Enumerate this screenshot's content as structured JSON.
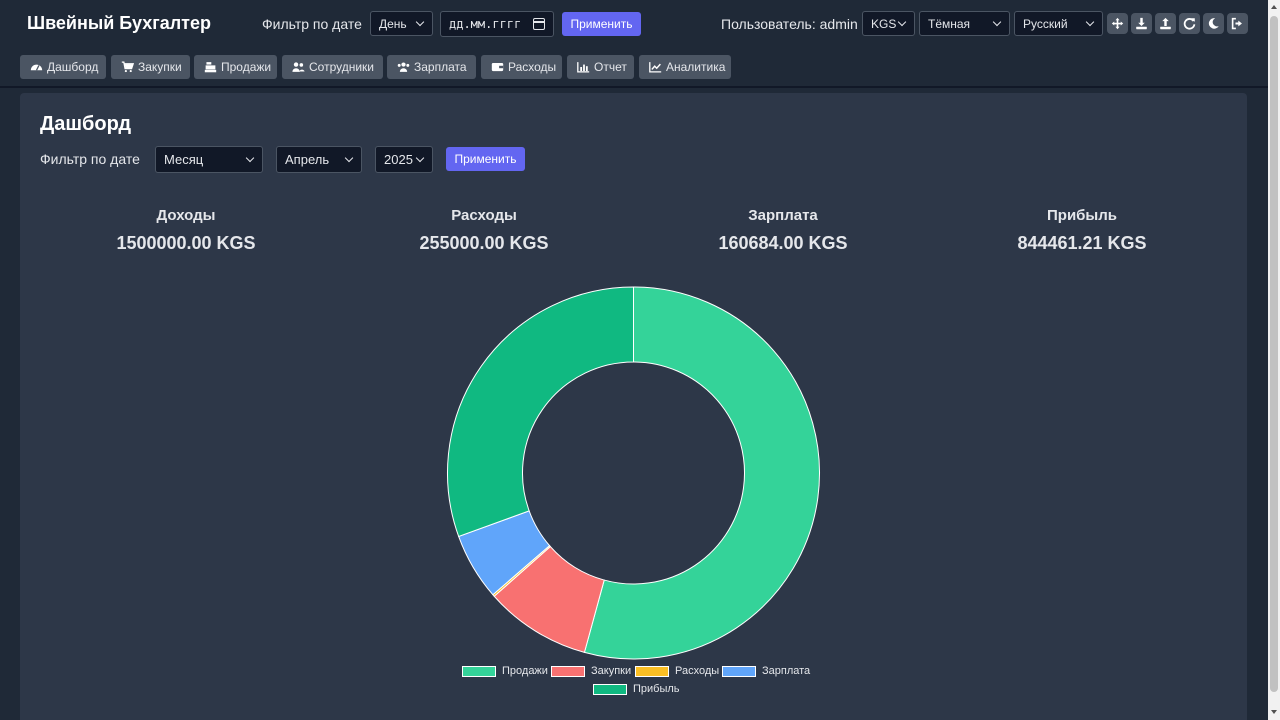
{
  "header": {
    "app_title": "Швейный Бухгалтер",
    "date_filter_label": "Фильтр по дате",
    "period_select": "День",
    "date_placeholder": "дд.мм.гггг",
    "apply_label": "Применить",
    "user_label": "Пользователь: admin",
    "currency_select": "KGS",
    "theme_select": "Тёмная",
    "language_select": "Русский",
    "icon_buttons": [
      "move-icon",
      "download-icon",
      "upload-icon",
      "refresh-icon",
      "moon-icon",
      "logout-icon"
    ]
  },
  "tabs": [
    {
      "label": "Дашборд",
      "icon": "tachometer-icon"
    },
    {
      "label": "Закупки",
      "icon": "cart-icon"
    },
    {
      "label": "Продажи",
      "icon": "cash-register-icon"
    },
    {
      "label": "Сотрудники",
      "icon": "user-friends-icon"
    },
    {
      "label": "Зарплата",
      "icon": "users-icon"
    },
    {
      "label": "Расходы",
      "icon": "wallet-icon"
    },
    {
      "label": "Отчет",
      "icon": "bar-chart-icon"
    },
    {
      "label": "Аналитика",
      "icon": "line-chart-icon"
    }
  ],
  "dashboard": {
    "title": "Дашборд",
    "filter_label": "Фильтр по дате",
    "period_select": "Месяц",
    "month_select": "Апрель",
    "year_select": "2025",
    "apply_label": "Применить",
    "stats": [
      {
        "label": "Доходы",
        "value": "1500000.00 KGS"
      },
      {
        "label": "Расходы",
        "value": "255000.00 KGS"
      },
      {
        "label": "Зарплата",
        "value": "160684.00 KGS"
      },
      {
        "label": "Прибыль",
        "value": "844461.21 KGS"
      }
    ]
  },
  "colors": {
    "accent": "#6366f1",
    "sales": "#34d399",
    "purchases": "#f87171",
    "expenses": "#fbbf24",
    "salary": "#60a5fa",
    "profit": "#10b981"
  },
  "chart_data": {
    "type": "pie",
    "donut": true,
    "labels": [
      "Продажи",
      "Закупки",
      "Расходы",
      "Зарплата",
      "Прибыль"
    ],
    "values": [
      1500000,
      255000,
      4854.79,
      160684,
      844461.21
    ],
    "colors": [
      "#34d399",
      "#f87171",
      "#fbbf24",
      "#60a5fa",
      "#10b981"
    ],
    "legend_position": "bottom"
  }
}
